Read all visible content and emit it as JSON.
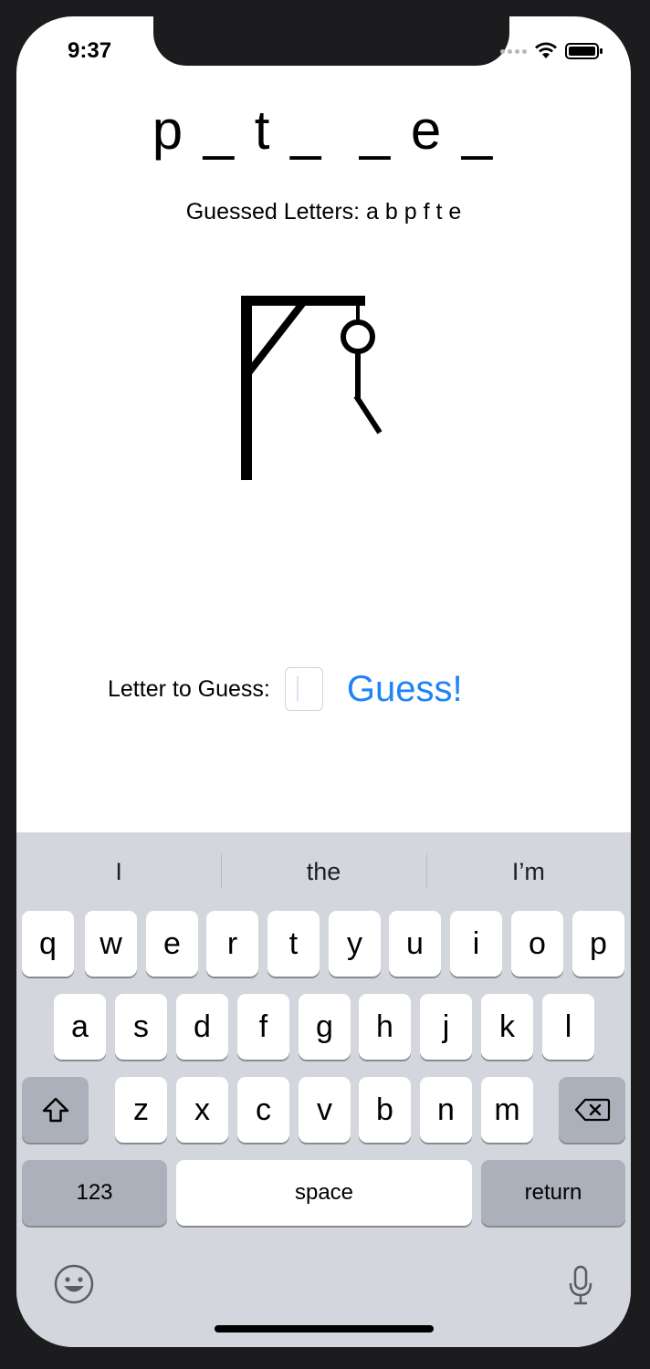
{
  "status_bar": {
    "time": "9:37"
  },
  "game": {
    "word_display": "p _ t _  _ e _",
    "guessed_letters": "Guessed Letters: a b p f t e"
  },
  "guess": {
    "label": "Letter to Guess:",
    "input_value": "",
    "button_label": "Guess!"
  },
  "keyboard": {
    "suggestions": [
      "I",
      "the",
      "I’m"
    ],
    "row1": [
      "q",
      "w",
      "e",
      "r",
      "t",
      "y",
      "u",
      "i",
      "o",
      "p"
    ],
    "row2": [
      "a",
      "s",
      "d",
      "f",
      "g",
      "h",
      "j",
      "k",
      "l"
    ],
    "row3": [
      "z",
      "x",
      "c",
      "v",
      "b",
      "n",
      "m"
    ],
    "numbers_label": "123",
    "space_label": "space",
    "return_label": "return",
    "icons": [
      "shift-icon",
      "backspace-icon",
      "emoji-icon",
      "microphone-icon"
    ]
  },
  "colors": {
    "accent": "#1f84f7",
    "keyboard_bg": "#d3d6dc",
    "dark_key": "#abb0ba"
  }
}
